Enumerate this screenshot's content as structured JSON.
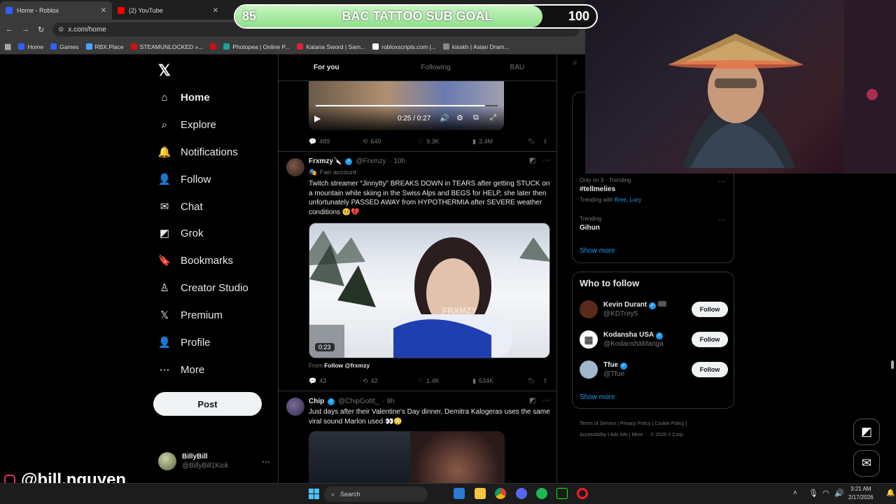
{
  "browser": {
    "tabs": [
      {
        "title": "Home - Roblox",
        "favicon_color": "#335fff",
        "active": true
      },
      {
        "title": "(2) YouTube",
        "favicon_color": "#ff0000",
        "active": false
      }
    ],
    "url": "x.com/home",
    "bookmarks": [
      {
        "label": "Home",
        "favicon_color": "#335fff"
      },
      {
        "label": "Games",
        "favicon_color": "#335fff"
      },
      {
        "label": "RBX.Place",
        "favicon_color": "#4aa3ff"
      },
      {
        "label": "STEAMUNLOCKED »...",
        "favicon_color": "#cc1111"
      },
      {
        "label": "",
        "favicon_color": "#cc1111"
      },
      {
        "label": "Photopea | Online P...",
        "favicon_color": "#18a497"
      },
      {
        "label": "Katana Sword | Sam...",
        "favicon_color": "#dd2233"
      },
      {
        "label": "robloxscripts.com |...",
        "favicon_color": "#ffffff"
      },
      {
        "label": "kisskh | Asian Dram...",
        "favicon_color": "#888888"
      }
    ]
  },
  "goal": {
    "current": "85",
    "title": "BAC TATTOO SUB GOAL",
    "target": "100",
    "progress_fraction": 0.85
  },
  "sidebar": {
    "logo": "𝕏",
    "items": [
      {
        "label": "Home",
        "icon": "home-icon",
        "glyph": "⌂"
      },
      {
        "label": "Explore",
        "icon": "search-icon",
        "glyph": "⌕"
      },
      {
        "label": "Notifications",
        "icon": "bell-icon",
        "glyph": "🔔"
      },
      {
        "label": "Follow",
        "icon": "person-plus-icon",
        "glyph": "👤"
      },
      {
        "label": "Chat",
        "icon": "mail-icon",
        "glyph": "✉"
      },
      {
        "label": "Grok",
        "icon": "grok-icon",
        "glyph": "◩"
      },
      {
        "label": "Bookmarks",
        "icon": "bookmark-icon",
        "glyph": "🔖"
      },
      {
        "label": "Creator Studio",
        "icon": "creator-icon",
        "glyph": "♙"
      },
      {
        "label": "Premium",
        "icon": "x-premium-icon",
        "glyph": "𝕏"
      },
      {
        "label": "Profile",
        "icon": "profile-icon",
        "glyph": "👤"
      },
      {
        "label": "More",
        "icon": "more-circle-icon",
        "glyph": "⋯"
      }
    ],
    "post_label": "Post",
    "account": {
      "name": "BillyBill",
      "handle": "@BillyBill1Kick",
      "more": "···"
    }
  },
  "feed": {
    "tabs": [
      "For you",
      "Following",
      "BAU"
    ],
    "video_time": "0:25 / 0:27",
    "video_progress_fraction": 0.93,
    "tweet0_stats": {
      "replies": "489",
      "reposts": "649",
      "likes": "9.3K",
      "views": "3.4M"
    },
    "tweet1": {
      "name": "Frxmzy🔪",
      "handle": "@Frxmzy",
      "time": "· 10h",
      "label": "Fan account",
      "text": "Twitch streamer “Jinnytty” BREAKS DOWN in TEARS after getting STUCK on a mountain while skiing in the Swiss Alps and BEGS for HELP, she later then unfortunately PASSED AWAY from HYPOTHERMIA after SEVERE weather conditions 🥺💔",
      "video_duration": "0:23",
      "watermark": "FRXMZY",
      "from_prefix": "From",
      "from_link": "Follow @frxmzy",
      "stats": {
        "replies": "43",
        "reposts": "42",
        "likes": "1.4K",
        "views": "534K"
      }
    },
    "tweet2": {
      "name": "Chip",
      "handle": "@ChipGotIt_",
      "time": "· 9h",
      "text": "Just days after their Valentine's Day dinner, Demitra Kalogeras uses the same viral sound Marlon used 👀😳"
    }
  },
  "right": {
    "search_icon": "⌕",
    "trends": [
      {
        "meta": "Only on X · Trending",
        "name": "#tellmelies",
        "sub_prefix": "Trending with",
        "sub_links": "Bree, Lucy"
      },
      {
        "meta": "Trending",
        "name": "Gihun"
      }
    ],
    "show_more": "Show more",
    "who_to_follow": {
      "title": "Who to follow",
      "people": [
        {
          "name": "Kevin Durant",
          "handle": "@KDTrey5",
          "avatar_color": "#5a2a1a"
        },
        {
          "name": "Kodansha USA",
          "handle": "@KodanshaManga",
          "avatar_color": "#ffffff"
        },
        {
          "name": "Tfue",
          "handle": "@Tfue",
          "avatar_color": "#9fb6cc"
        }
      ],
      "follow_label": "Follow",
      "show_more": "Show more"
    },
    "footer": [
      "Terms of Service",
      "Privacy Policy",
      "Cookie Policy",
      "Accessibility",
      "Ads info",
      "More ···",
      "© 2026 X Corp."
    ]
  },
  "overlay": {
    "instagram": "@bill.nguyen"
  },
  "taskbar": {
    "search_placeholder": "Search",
    "time": "3:21 AM",
    "date": "2/17/2026"
  }
}
